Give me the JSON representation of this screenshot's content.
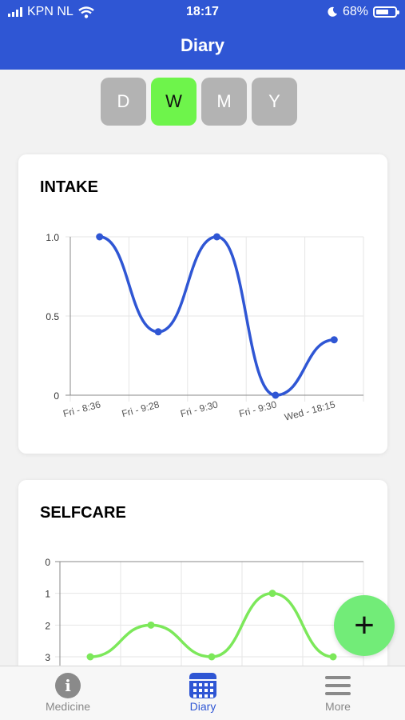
{
  "status_bar": {
    "carrier": "KPN NL",
    "time": "18:17",
    "battery": "68%",
    "battery_level": 0.68
  },
  "header": {
    "title": "Diary"
  },
  "periods": [
    {
      "label": "D",
      "active": false
    },
    {
      "label": "W",
      "active": true
    },
    {
      "label": "M",
      "active": false
    },
    {
      "label": "Y",
      "active": false
    }
  ],
  "colors": {
    "header": "#2f56d4",
    "active_period": "#6ef44b",
    "intake_line": "#2f56d4",
    "selfcare_line": "#7ce85a",
    "fab": "#72ec78"
  },
  "intake": {
    "title": "INTAKE"
  },
  "selfcare": {
    "title": "SELFCARE"
  },
  "chart_data": [
    {
      "type": "line",
      "title": "INTAKE",
      "categories": [
        "Fri - 8:36",
        "Fri - 9:28",
        "Fri - 9:30",
        "Fri - 9:30",
        "Wed - 18:15"
      ],
      "values": [
        1.0,
        0.4,
        1.0,
        0.0,
        0.35
      ],
      "y_ticks": [
        "1.0",
        "0.5",
        "0"
      ],
      "ylim": [
        0,
        1
      ],
      "grid": true
    },
    {
      "type": "line",
      "title": "SELFCARE",
      "values": [
        3,
        2,
        3,
        1,
        3
      ],
      "y_ticks": [
        "0",
        "1",
        "2",
        "3"
      ],
      "ylim": [
        0,
        3
      ],
      "y_inverted": true,
      "grid": true
    }
  ],
  "fab": {
    "icon": "plus-icon",
    "label": "+"
  },
  "tabs": [
    {
      "label": "Medicine",
      "icon": "info-icon",
      "active": false
    },
    {
      "label": "Diary",
      "icon": "calendar-icon",
      "active": true
    },
    {
      "label": "More",
      "icon": "menu-icon",
      "active": false
    }
  ]
}
